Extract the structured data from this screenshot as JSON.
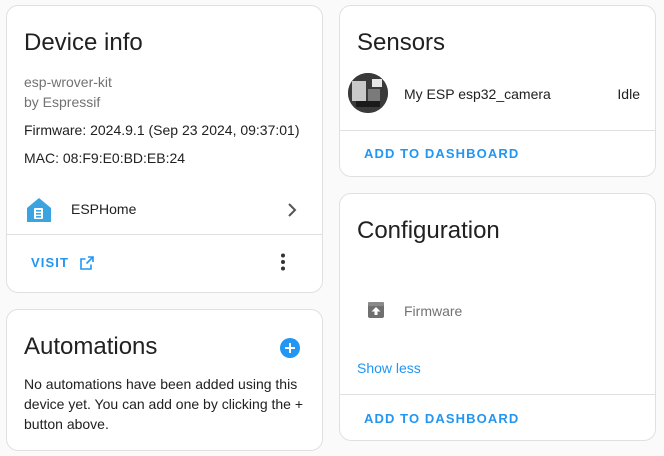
{
  "device_info": {
    "title": "Device info",
    "model": "esp-wrover-kit",
    "manufacturer": "by Espressif",
    "firmware": "Firmware: 2024.9.1 (Sep 23 2024, 09:37:01)",
    "mac": "MAC: 08:F9:E0:BD:EB:24",
    "integration_label": "ESPHome",
    "visit_label": "VISIT",
    "colors": {
      "integration_icon": "#3aa3e0"
    }
  },
  "automations": {
    "title": "Automations",
    "empty_text": "No automations have been added using this device yet. You can add one by clicking the + button above.",
    "colors": {
      "add_icon": "#2196f3"
    }
  },
  "sensors": {
    "title": "Sensors",
    "items": [
      {
        "name": "My ESP esp32_camera",
        "state": "Idle"
      }
    ],
    "add_label": "ADD TO DASHBOARD"
  },
  "configuration": {
    "title": "Configuration",
    "items": [
      {
        "name": "Firmware"
      }
    ],
    "show_less_label": "Show less",
    "add_label": "ADD TO DASHBOARD"
  },
  "colors": {
    "accent": "#2196f3",
    "divider": "#e0e0e0",
    "secondary_text": "#727272"
  }
}
